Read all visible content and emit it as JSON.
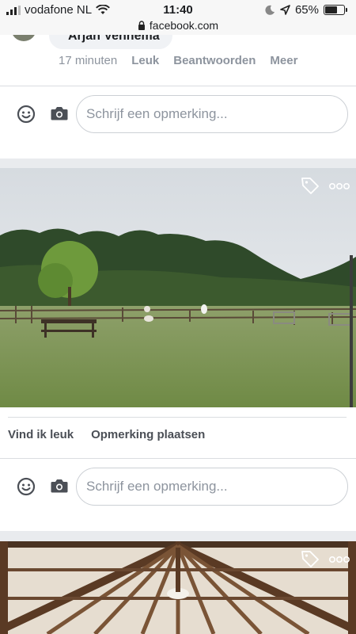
{
  "status_bar": {
    "carrier": "vodafone NL",
    "time": "11:40",
    "battery": "65%",
    "battery_level": 0.65,
    "url": "facebook.com",
    "icons": [
      "signal-icon",
      "wifi-icon",
      "moon-icon",
      "location-icon",
      "battery-icon",
      "lock-icon"
    ]
  },
  "comment": {
    "author": "Arjan Venhema",
    "time": "17 minuten",
    "like_label": "Leuk",
    "reply_label": "Beantwoorden",
    "more_label": "Meer"
  },
  "composer": {
    "placeholder": "Schrijf een opmerking..."
  },
  "post": {
    "like_label": "Vind ik leuk",
    "comment_label": "Opmerking plaatsen",
    "icons": [
      "tag-icon",
      "more-icon"
    ]
  },
  "colors": {
    "background": "#e9ebee",
    "secondary_text": "#8d949e",
    "icon": "#4b4f56"
  }
}
